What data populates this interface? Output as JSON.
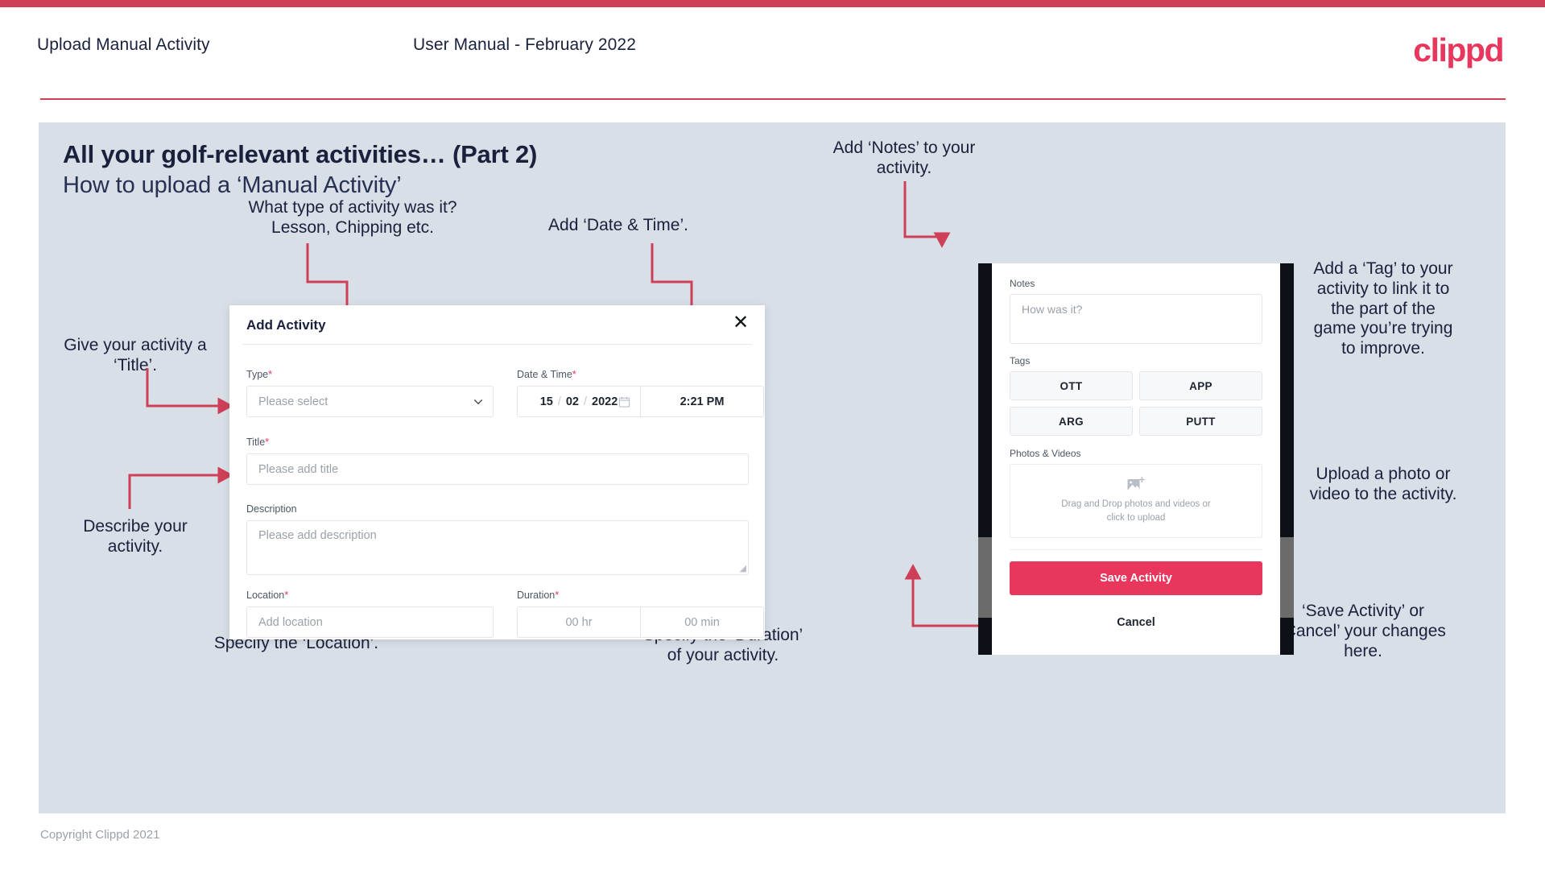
{
  "header": {
    "title": "Upload Manual Activity",
    "subtitle": "User Manual - February 2022",
    "logo": "clippd"
  },
  "slide": {
    "title": "All your golf-relevant activities… (Part 2)",
    "subtitle": "How to upload a ‘Manual Activity’"
  },
  "annotations": {
    "type": "What type of activity was it?\nLesson, Chipping etc.",
    "datetime": "Add ‘Date & Time’.",
    "title": "Give your activity a\n‘Title’.",
    "description": "Describe your\nactivity.",
    "location": "Specify the ‘Location’.",
    "duration": "Specify the ‘Duration’\nof your activity.",
    "notes": "Add ‘Notes’ to your\nactivity.",
    "tag": "Add a ‘Tag’ to your\nactivity to link it to\nthe part of the\ngame you’re trying\nto improve.",
    "upload": "Upload a photo or\nvideo to the activity.",
    "save_cancel": "‘Save Activity’ or\n‘Cancel’ your changes\nhere."
  },
  "modal": {
    "title": "Add Activity",
    "close_icon": "close-icon",
    "fields": {
      "type": {
        "label": "Type",
        "required": "*",
        "placeholder": "Please select"
      },
      "datetime": {
        "label": "Date & Time",
        "required": "*",
        "day": "15",
        "month": "02",
        "year": "2022",
        "sep": "/",
        "time": "2:21 PM"
      },
      "title": {
        "label": "Title",
        "required": "*",
        "placeholder": "Please add title"
      },
      "description": {
        "label": "Description",
        "placeholder": "Please add description"
      },
      "location": {
        "label": "Location",
        "required": "*",
        "placeholder": "Add location"
      },
      "duration": {
        "label": "Duration",
        "required": "*",
        "hours_placeholder": "00 hr",
        "minutes_placeholder": "00 min"
      }
    }
  },
  "phone": {
    "notes_label": "Notes",
    "notes_placeholder": "How was it?",
    "tags_label": "Tags",
    "tags": [
      "OTT",
      "APP",
      "ARG",
      "PUTT"
    ],
    "photos_label": "Photos & Videos",
    "drop_text": "Drag and Drop photos and videos or\nclick to upload",
    "save_label": "Save Activity",
    "cancel_label": "Cancel"
  },
  "footer": {
    "copyright": "Copyright Clippd 2021"
  },
  "colors": {
    "brand": "#e8365d",
    "brand_bar": "#cf4058",
    "slide_bg": "#d9dfe7",
    "ink": "#19213d",
    "arrow": "#cf4058"
  }
}
